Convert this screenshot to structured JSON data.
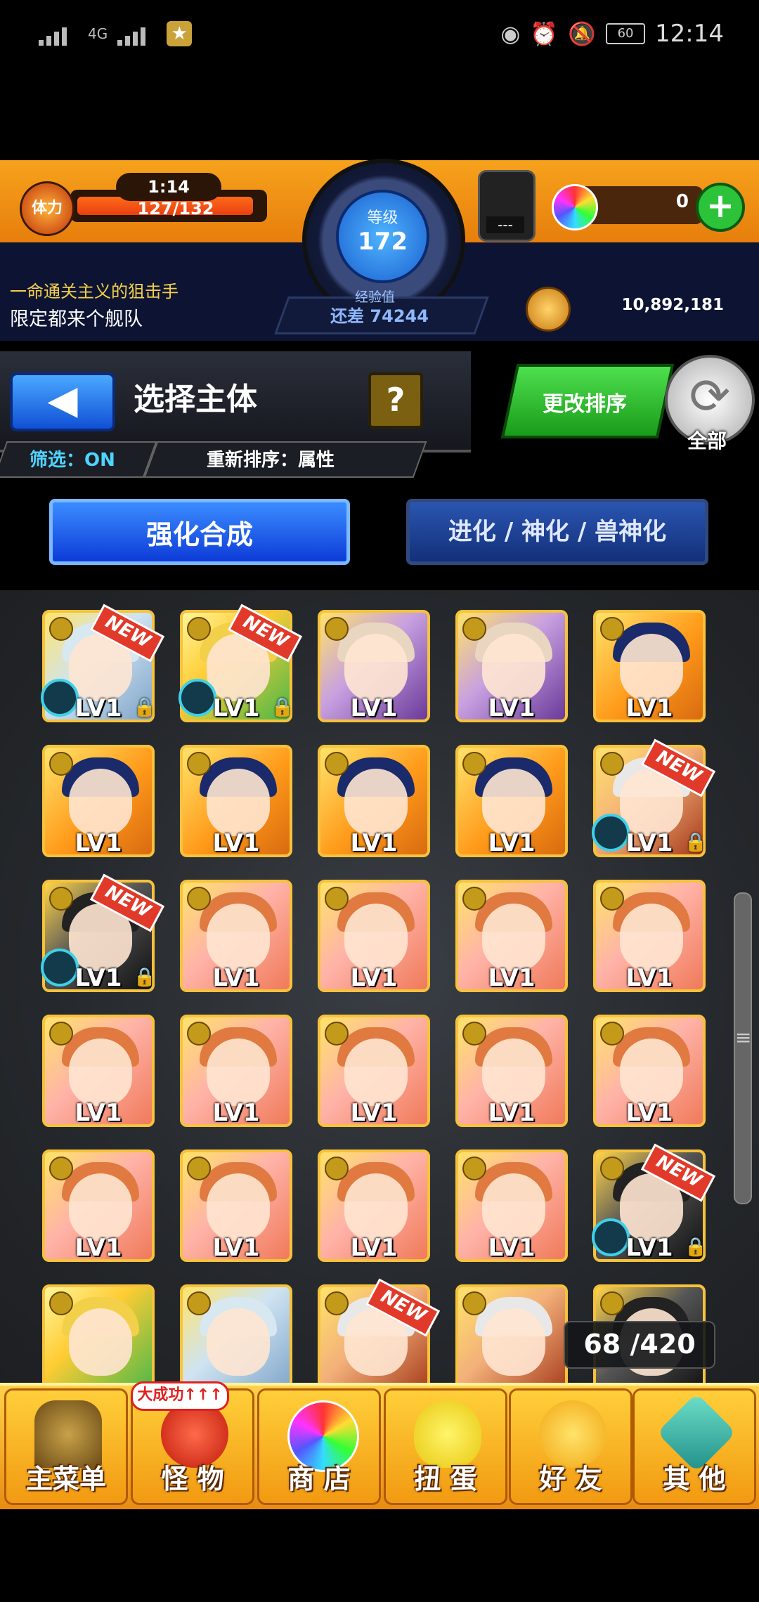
{
  "status_bar": {
    "network": "4G",
    "battery": "60",
    "time": "12:14"
  },
  "header": {
    "stamina_label": "体力",
    "stamina_timer": "1:14",
    "stamina_value": "127/132",
    "stamina_fraction": 0.96,
    "level_label": "等级",
    "level": "172",
    "exp_label": "经验值",
    "exp_remaining": "还差 74244",
    "potion_value": "---",
    "orb_count": "0",
    "plus_label": "+",
    "notice_line1": "一命通关主义的狙击手",
    "notice_line2": "限定都来个舰队",
    "gold": "10,892,181"
  },
  "panel": {
    "back_icon": "◀",
    "title": "选择主体",
    "help": "?",
    "filter": "筛选：ON",
    "sort_label": "重新排序：属性",
    "sort_button": "更改排序",
    "all_button": "全部"
  },
  "tabs": {
    "enhance": "强化合成",
    "evolve": "进化 / 神化 / 兽神化"
  },
  "monsters": {
    "level_text": "LV1",
    "new_text": "NEW"
  },
  "box_count": "68 /420",
  "nav": {
    "badge": "大成功↑↑↑",
    "items": [
      "主菜单",
      "怪 物",
      "商 店",
      "扭 蛋",
      "好 友",
      "其 他"
    ]
  }
}
